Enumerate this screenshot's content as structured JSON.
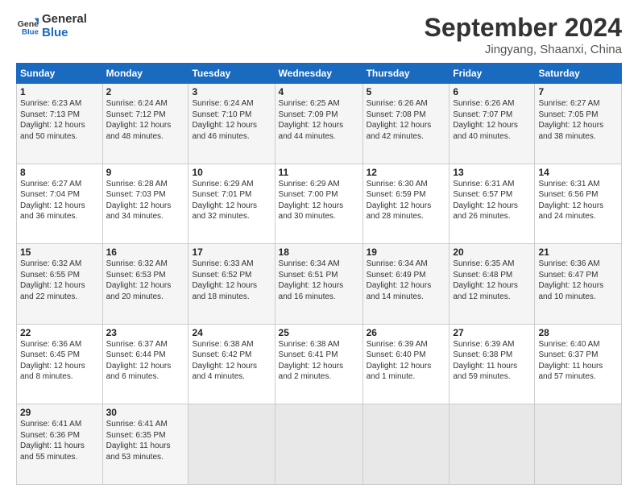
{
  "header": {
    "logo_line1": "General",
    "logo_line2": "Blue",
    "month": "September 2024",
    "location": "Jingyang, Shaanxi, China"
  },
  "weekdays": [
    "Sunday",
    "Monday",
    "Tuesday",
    "Wednesday",
    "Thursday",
    "Friday",
    "Saturday"
  ],
  "weeks": [
    [
      {
        "day": "1",
        "info": "Sunrise: 6:23 AM\nSunset: 7:13 PM\nDaylight: 12 hours\nand 50 minutes."
      },
      {
        "day": "2",
        "info": "Sunrise: 6:24 AM\nSunset: 7:12 PM\nDaylight: 12 hours\nand 48 minutes."
      },
      {
        "day": "3",
        "info": "Sunrise: 6:24 AM\nSunset: 7:10 PM\nDaylight: 12 hours\nand 46 minutes."
      },
      {
        "day": "4",
        "info": "Sunrise: 6:25 AM\nSunset: 7:09 PM\nDaylight: 12 hours\nand 44 minutes."
      },
      {
        "day": "5",
        "info": "Sunrise: 6:26 AM\nSunset: 7:08 PM\nDaylight: 12 hours\nand 42 minutes."
      },
      {
        "day": "6",
        "info": "Sunrise: 6:26 AM\nSunset: 7:07 PM\nDaylight: 12 hours\nand 40 minutes."
      },
      {
        "day": "7",
        "info": "Sunrise: 6:27 AM\nSunset: 7:05 PM\nDaylight: 12 hours\nand 38 minutes."
      }
    ],
    [
      {
        "day": "8",
        "info": "Sunrise: 6:27 AM\nSunset: 7:04 PM\nDaylight: 12 hours\nand 36 minutes."
      },
      {
        "day": "9",
        "info": "Sunrise: 6:28 AM\nSunset: 7:03 PM\nDaylight: 12 hours\nand 34 minutes."
      },
      {
        "day": "10",
        "info": "Sunrise: 6:29 AM\nSunset: 7:01 PM\nDaylight: 12 hours\nand 32 minutes."
      },
      {
        "day": "11",
        "info": "Sunrise: 6:29 AM\nSunset: 7:00 PM\nDaylight: 12 hours\nand 30 minutes."
      },
      {
        "day": "12",
        "info": "Sunrise: 6:30 AM\nSunset: 6:59 PM\nDaylight: 12 hours\nand 28 minutes."
      },
      {
        "day": "13",
        "info": "Sunrise: 6:31 AM\nSunset: 6:57 PM\nDaylight: 12 hours\nand 26 minutes."
      },
      {
        "day": "14",
        "info": "Sunrise: 6:31 AM\nSunset: 6:56 PM\nDaylight: 12 hours\nand 24 minutes."
      }
    ],
    [
      {
        "day": "15",
        "info": "Sunrise: 6:32 AM\nSunset: 6:55 PM\nDaylight: 12 hours\nand 22 minutes."
      },
      {
        "day": "16",
        "info": "Sunrise: 6:32 AM\nSunset: 6:53 PM\nDaylight: 12 hours\nand 20 minutes."
      },
      {
        "day": "17",
        "info": "Sunrise: 6:33 AM\nSunset: 6:52 PM\nDaylight: 12 hours\nand 18 minutes."
      },
      {
        "day": "18",
        "info": "Sunrise: 6:34 AM\nSunset: 6:51 PM\nDaylight: 12 hours\nand 16 minutes."
      },
      {
        "day": "19",
        "info": "Sunrise: 6:34 AM\nSunset: 6:49 PM\nDaylight: 12 hours\nand 14 minutes."
      },
      {
        "day": "20",
        "info": "Sunrise: 6:35 AM\nSunset: 6:48 PM\nDaylight: 12 hours\nand 12 minutes."
      },
      {
        "day": "21",
        "info": "Sunrise: 6:36 AM\nSunset: 6:47 PM\nDaylight: 12 hours\nand 10 minutes."
      }
    ],
    [
      {
        "day": "22",
        "info": "Sunrise: 6:36 AM\nSunset: 6:45 PM\nDaylight: 12 hours\nand 8 minutes."
      },
      {
        "day": "23",
        "info": "Sunrise: 6:37 AM\nSunset: 6:44 PM\nDaylight: 12 hours\nand 6 minutes."
      },
      {
        "day": "24",
        "info": "Sunrise: 6:38 AM\nSunset: 6:42 PM\nDaylight: 12 hours\nand 4 minutes."
      },
      {
        "day": "25",
        "info": "Sunrise: 6:38 AM\nSunset: 6:41 PM\nDaylight: 12 hours\nand 2 minutes."
      },
      {
        "day": "26",
        "info": "Sunrise: 6:39 AM\nSunset: 6:40 PM\nDaylight: 12 hours\nand 1 minute."
      },
      {
        "day": "27",
        "info": "Sunrise: 6:39 AM\nSunset: 6:38 PM\nDaylight: 11 hours\nand 59 minutes."
      },
      {
        "day": "28",
        "info": "Sunrise: 6:40 AM\nSunset: 6:37 PM\nDaylight: 11 hours\nand 57 minutes."
      }
    ],
    [
      {
        "day": "29",
        "info": "Sunrise: 6:41 AM\nSunset: 6:36 PM\nDaylight: 11 hours\nand 55 minutes."
      },
      {
        "day": "30",
        "info": "Sunrise: 6:41 AM\nSunset: 6:35 PM\nDaylight: 11 hours\nand 53 minutes."
      },
      {
        "day": "",
        "info": ""
      },
      {
        "day": "",
        "info": ""
      },
      {
        "day": "",
        "info": ""
      },
      {
        "day": "",
        "info": ""
      },
      {
        "day": "",
        "info": ""
      }
    ]
  ]
}
